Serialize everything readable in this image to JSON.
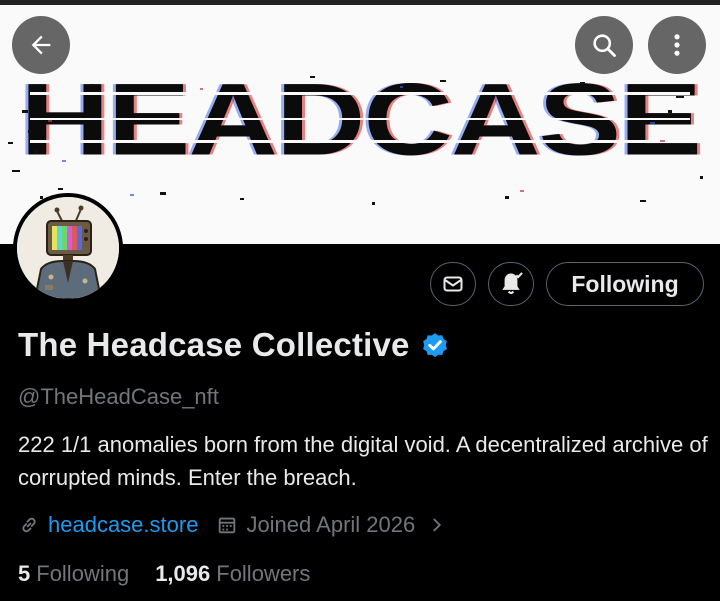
{
  "banner": {
    "title": "HEADCASE",
    "background": "#fafafa",
    "text_color": "#0b0b0b"
  },
  "header": {
    "back_icon": "arrow-left-icon",
    "search_icon": "search-icon",
    "more_icon": "more-vertical-icon"
  },
  "actions": {
    "message_icon": "envelope-icon",
    "notify_icon": "bell-check-icon",
    "follow_label": "Following"
  },
  "profile": {
    "name": "The Headcase Collective",
    "verified_icon": "verified-badge-icon",
    "verified_color": "#1d9bf0",
    "handle": "@TheHeadCase_nft",
    "bio": "222 1/1 anomalies born from the digital void. A decentralized archive of corrupted minds. Enter the breach.",
    "website": "headcase.store",
    "joined": "Joined April 2026"
  },
  "stats": {
    "following_count": "5",
    "following_label": "Following",
    "followers_count": "1,096",
    "followers_label": "Followers"
  },
  "colors": {
    "accent": "#1d9bf0",
    "muted": "#71767b",
    "text": "#e7e9ea",
    "background": "#000000"
  }
}
